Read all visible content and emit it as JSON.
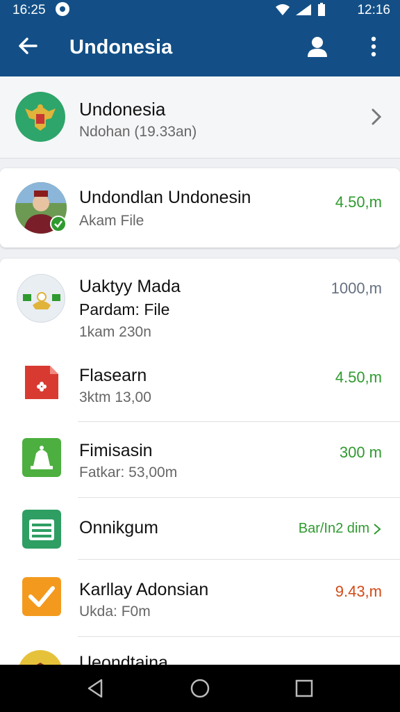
{
  "status_bar": {
    "time_left": "16:25",
    "time_right": "12:16"
  },
  "app_bar": {
    "title": "Undonesia"
  },
  "header_card": {
    "title": "Undonesia",
    "subtitle": "Ndohan (19.33an)"
  },
  "second_card": {
    "title": "Undondlan Undonesin",
    "subtitle": "Akam File",
    "amount": "4.50,m"
  },
  "list": {
    "items": [
      {
        "title": "Uaktyy Mada",
        "subtitle": "Pardam: File",
        "meta": "1kam 230n",
        "amount": "1000,m",
        "icon": "emblem-icon",
        "amount_color": "#667080"
      },
      {
        "title": "Flasearn",
        "subtitle": "3ktm 13,00",
        "amount": "4.50,m",
        "icon": "file-icon",
        "amount_color": "#2f9a2f"
      },
      {
        "title": "Fimisasin",
        "subtitle": "Fatkar: 53,00m",
        "amount": "300 m",
        "icon": "bell-icon",
        "amount_color": "#2f9a2f"
      },
      {
        "title": "Onnikgum",
        "subtitle": "",
        "amount": "Bar/In2 dim",
        "icon": "calendar-icon",
        "amount_color": "#2f9a2f"
      },
      {
        "title": "Karllay Adonsian",
        "subtitle": "Ukda: F0m",
        "amount": "9.43,m",
        "icon": "check-icon",
        "amount_color": "#d24a16"
      },
      {
        "title": "Ueondtaina",
        "subtitle": "",
        "amount": "",
        "icon": "coin-icon",
        "amount_color": "#2f9a2f"
      }
    ]
  },
  "colors": {
    "primary": "#134f86",
    "green": "#2f9a2f",
    "orange": "#d24a16"
  }
}
